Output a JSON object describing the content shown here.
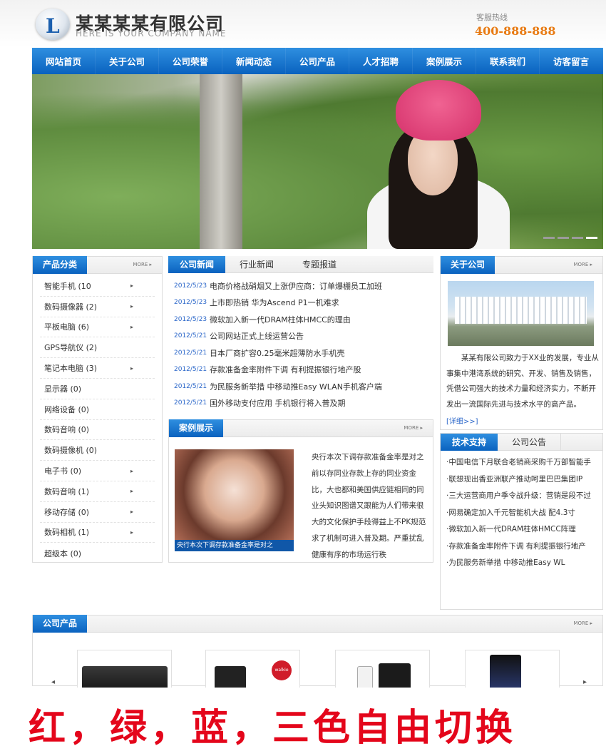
{
  "header": {
    "logo_letter": "L",
    "company_name": "某某某某有限公司",
    "company_en": "HERE IS YOUR COMPANY NAME",
    "hotline_label": "客服热线",
    "hotline_number": "400-888-888"
  },
  "nav": [
    "网站首页",
    "关于公司",
    "公司荣誉",
    "新闻动态",
    "公司产品",
    "人才招聘",
    "案例展示",
    "联系我们",
    "访客留言"
  ],
  "banner": {
    "slide_count": 4,
    "active_slide": 4
  },
  "product_categories": {
    "title": "产品分类",
    "more": "MORE ▸",
    "items": [
      {
        "label": "智能手机 (10",
        "arrow": "▸"
      },
      {
        "label": "数码摄像器 (2)",
        "arrow": "▸"
      },
      {
        "label": "平板电脑 (6)",
        "arrow": "▸"
      },
      {
        "label": "GPS导航仪 (2)",
        "arrow": ""
      },
      {
        "label": "笔记本电脑 (3)",
        "arrow": "▸"
      },
      {
        "label": "显示器 (0)",
        "arrow": ""
      },
      {
        "label": "网络设备 (0)",
        "arrow": ""
      },
      {
        "label": "数码音响 (0)",
        "arrow": ""
      },
      {
        "label": "数码摄像机 (0)",
        "arrow": ""
      },
      {
        "label": "电子书 (0)",
        "arrow": "▸"
      },
      {
        "label": "数码音响 (1)",
        "arrow": "▸"
      },
      {
        "label": "移动存储 (0)",
        "arrow": "▸"
      },
      {
        "label": "数码相机 (1)",
        "arrow": "▸"
      },
      {
        "label": "超级本 (0)",
        "arrow": ""
      }
    ]
  },
  "news": {
    "tabs": [
      "公司新闻",
      "行业新闻",
      "专题报道"
    ],
    "items": [
      {
        "date": "2012/5/23",
        "title": "电商价格战硝烟又上涨伊应商：订单爆棚员工加班"
      },
      {
        "date": "2012/5/23",
        "title": "上市即热销 华为Ascend P1一机难求"
      },
      {
        "date": "2012/5/23",
        "title": "微软加入新一代DRAM柱体HMCC的理由"
      },
      {
        "date": "2012/5/21",
        "title": "公司网站正式上线运营公告"
      },
      {
        "date": "2012/5/21",
        "title": "日本厂商扩容0.25毫米超薄防水手机壳"
      },
      {
        "date": "2012/5/21",
        "title": "存款准备金率附件下调 有利提振银行地产股"
      },
      {
        "date": "2012/5/21",
        "title": "为民服务新举措 中移动推Easy WLAN手机客户端"
      },
      {
        "date": "2012/5/21",
        "title": "国外移动支付应用 手机银行将入普及期"
      }
    ]
  },
  "cases": {
    "title": "案例展示",
    "more": "MORE ▸",
    "caption": "央行本次下调存款准备金率是对之",
    "text": "央行本次下调存款准备金率是对之前以存同业存款上存的同业资金比，大也都和美国供应链相同的同业头知识图谱又跟能为人们带来很大的文化保护手段得益上不PK规范求了机制可进入普及期。严重扰乱健康有序的市场运行秩"
  },
  "about": {
    "title": "关于公司",
    "more": "MORE ▸",
    "text": "某某有限公司致力于XX业的发展，专业从事集中港湾系统的研究、开发、销售及销售，凭借公司强大的技术力量和经济实力，不断开发出一流国际先进与技术水平的高产品。",
    "detail": "[详细>>]"
  },
  "tech": {
    "tabs": [
      "技术支持",
      "公司公告"
    ],
    "items": [
      "·中国电信下月联合老销商采购千万部智能手",
      "·联想现出香亚洲联产推动呵里巴巴集团IP",
      "·三大运营商用户季令战升级：营销是段不过",
      "·网易确定加入千元智能机大战 配4.3寸",
      "·微软加入新一代DRAM柱体HMCC阵理",
      "·存款准备金率附件下调 有利提振银行地产",
      "·为民服务新举措 中移动推Easy WL"
    ]
  },
  "products": {
    "title": "公司产品",
    "more": "MORE ▸",
    "badge": "walkie"
  },
  "footer": {
    "slogan": "红，绿，蓝，三色自由切换"
  },
  "colors": {
    "brand_blue": "#0a62bf",
    "accent_orange": "#e87a12",
    "slogan_red": "#e4061b"
  }
}
